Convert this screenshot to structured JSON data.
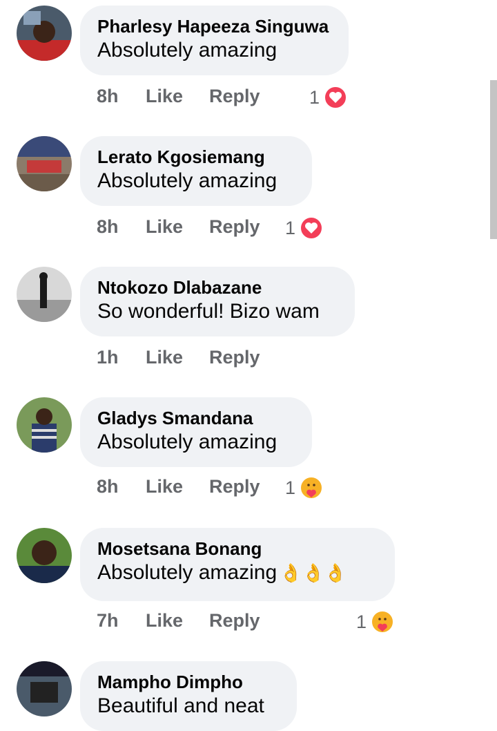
{
  "comments": [
    {
      "name": "Pharlesy Hapeeza Singuwa",
      "text": "Absolutely amazing",
      "time": "8h",
      "like": "Like",
      "reply": "Reply",
      "reaction_count": "1",
      "reaction": "love-icon",
      "emojis": ""
    },
    {
      "name": "Lerato Kgosiemang",
      "text": "Absolutely amazing",
      "time": "8h",
      "like": "Like",
      "reply": "Reply",
      "reaction_count": "1",
      "reaction": "love-icon",
      "emojis": ""
    },
    {
      "name": "Ntokozo Dlabazane",
      "text": "So wonderful! Bizo wam",
      "time": "1h",
      "like": "Like",
      "reply": "Reply",
      "reaction_count": "",
      "reaction": "",
      "emojis": ""
    },
    {
      "name": "Gladys Smandana",
      "text": "Absolutely amazing",
      "time": "8h",
      "like": "Like",
      "reply": "Reply",
      "reaction_count": "1",
      "reaction": "care-icon",
      "emojis": ""
    },
    {
      "name": "Mosetsana Bonang",
      "text": "Absolutely amazing",
      "time": "7h",
      "like": "Like",
      "reply": "Reply",
      "reaction_count": "1",
      "reaction": "care-icon",
      "emojis": "👌👌👌"
    },
    {
      "name": "Mampho Dimpho",
      "text": "Beautiful and neat",
      "time": "",
      "like": "",
      "reply": "",
      "reaction_count": "",
      "reaction": "",
      "emojis": ""
    }
  ],
  "colors": {
    "bubble": "#f0f2f5",
    "meta": "#65676b",
    "love": "#f33e58",
    "care": "#f7b125"
  }
}
